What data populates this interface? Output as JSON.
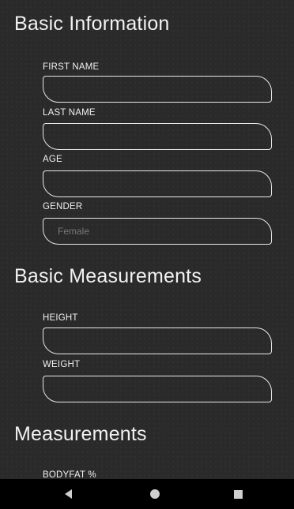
{
  "sections": {
    "basic_info": {
      "title": "Basic Information",
      "first_name": {
        "label": "FIRST NAME",
        "value": ""
      },
      "last_name": {
        "label": "LAST NAME",
        "value": ""
      },
      "age": {
        "label": "AGE",
        "value": ""
      },
      "gender": {
        "label": "GENDER",
        "value": "Female"
      }
    },
    "basic_measurements": {
      "title": "Basic Measurements",
      "height": {
        "label": "HEIGHT",
        "value": ""
      },
      "weight": {
        "label": "WEIGHT",
        "value": ""
      }
    },
    "measurements": {
      "title": "Measurements",
      "bodyfat": {
        "label": "BODYFAT %"
      }
    }
  },
  "navbar": {
    "back_icon": "back-triangle-icon",
    "home_icon": "home-circle-icon",
    "recents_icon": "recents-square-icon"
  },
  "colors": {
    "background": "#2a2a2a",
    "field_border": "#e8e8e8",
    "text": "#ffffff",
    "placeholder": "#777777",
    "navbar": "#000000"
  }
}
